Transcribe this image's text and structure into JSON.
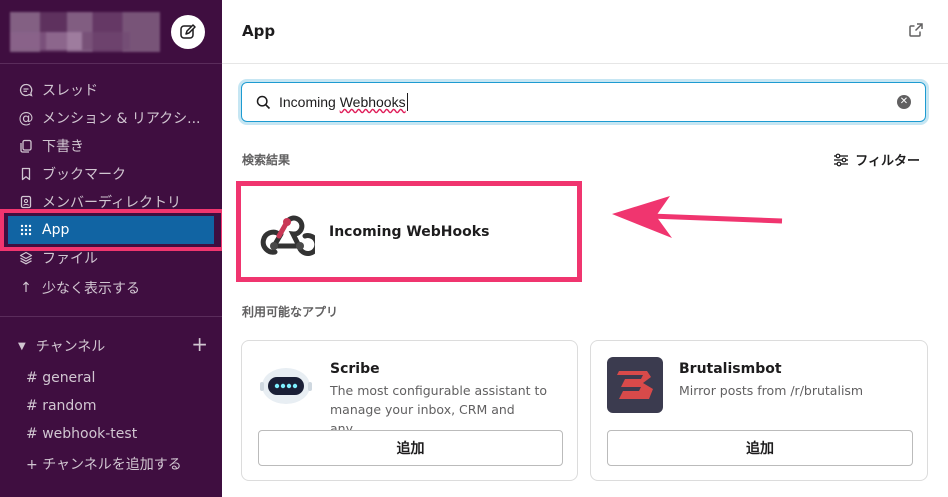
{
  "sidebar": {
    "nav": [
      {
        "label": "スレッド",
        "icon": "threads-icon"
      },
      {
        "label": "メンション & リアクシ...",
        "icon": "mention-icon"
      },
      {
        "label": "下書き",
        "icon": "drafts-icon"
      },
      {
        "label": "ブックマーク",
        "icon": "bookmark-icon"
      },
      {
        "label": "メンバーディレクトリ",
        "icon": "directory-icon"
      },
      {
        "label": "App",
        "icon": "apps-grid-icon"
      },
      {
        "label": "ファイル",
        "icon": "files-icon"
      },
      {
        "label": "少なく表示する",
        "icon": "arrow-up-icon"
      }
    ],
    "channels_header": "チャンネル",
    "channels": [
      "general",
      "random",
      "webhook-test"
    ],
    "channel_prefix": "#",
    "add_channel": "チャンネルを追加する",
    "add_prefix": "+"
  },
  "main": {
    "title": "App",
    "search": {
      "value_pre": "Incoming ",
      "value_spell": "Webhooks"
    },
    "results_label": "検索結果",
    "filter_label": "フィルター",
    "result": {
      "name": "Incoming WebHooks"
    },
    "available_label": "利用可能なアプリ",
    "apps": [
      {
        "name": "Scribe",
        "desc": "The most configurable assistant to manage your inbox, CRM and any…",
        "add": "追加"
      },
      {
        "name": "Brutalismbot",
        "desc": "Mirror posts from /r/brutalism",
        "add": "追加"
      }
    ]
  },
  "colors": {
    "sidebar_bg": "#3f0e40",
    "active_item": "#1164a3",
    "highlight": "#f0356f",
    "search_focus": "#1d9bd1"
  }
}
